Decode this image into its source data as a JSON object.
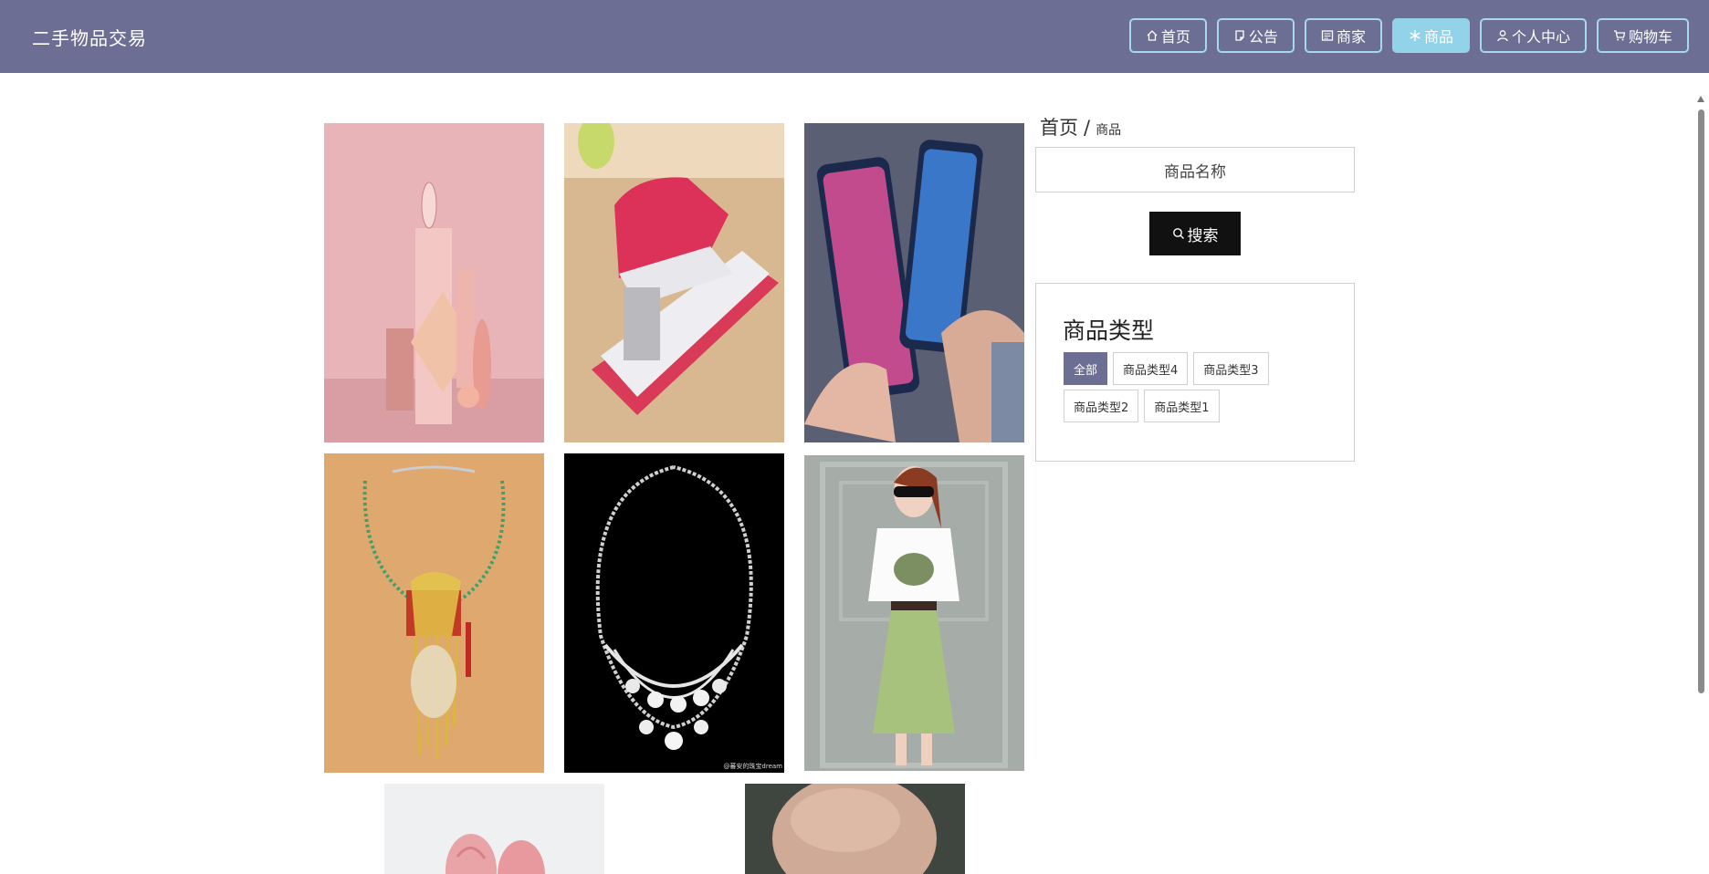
{
  "app": {
    "title": "二手物品交易"
  },
  "nav": {
    "home": "首页",
    "notice": "公告",
    "merchant": "商家",
    "goods": "商品",
    "profile": "个人中心",
    "cart": "购物车"
  },
  "breadcrumb": {
    "root": "首页",
    "separator": "/",
    "current": "商品"
  },
  "search": {
    "placeholder": "商品名称",
    "button": "搜索"
  },
  "categories": {
    "title": "商品类型",
    "items": [
      "全部",
      "商品类型4",
      "商品类型3",
      "商品类型2",
      "商品类型1"
    ],
    "active": "全部"
  },
  "products": [
    {
      "name": "cosmetics"
    },
    {
      "name": "stapler"
    },
    {
      "name": "phones"
    },
    {
      "name": "gold-necklace"
    },
    {
      "name": "diamond-necklace"
    },
    {
      "name": "dress-outfit"
    },
    {
      "name": "roses"
    },
    {
      "name": "ring"
    }
  ],
  "watermark": "@蕃安的珠宝dream",
  "colors": {
    "header": "#6d6e94",
    "nav_active": "#93d3ea",
    "nav_border": "#a9d7ee",
    "search_button": "#111111",
    "tag_active": "#6d6e94"
  }
}
